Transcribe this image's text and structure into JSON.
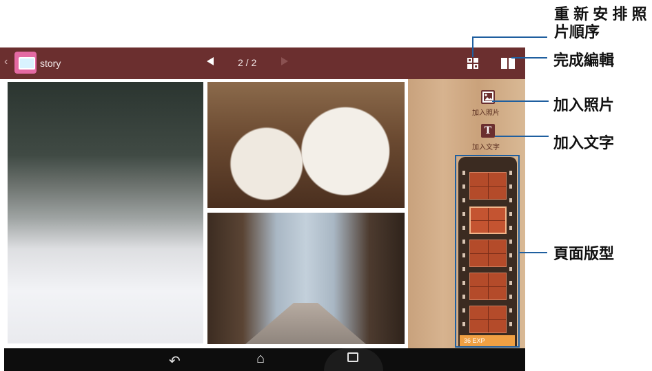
{
  "app": {
    "title": "story",
    "page_indicator": "2 / 2"
  },
  "tools": {
    "add_photo_label": "加入照片",
    "add_text_label": "加入文字",
    "add_text_glyph": "T"
  },
  "film_strip": {
    "tag": "36 EXP"
  },
  "callouts": {
    "reorder": "重 新 安 排 照\n片順序",
    "done": "完成編輯",
    "add_photo": "加入照片",
    "add_text": "加入文字",
    "layout": "頁面版型"
  },
  "nav": {
    "back_icon": "↶",
    "home_icon": "⌂"
  },
  "colors": {
    "topbar": "#6b2f2f",
    "callout_line": "#1f5f9f",
    "accent_app_icon": "#e46aa3"
  }
}
